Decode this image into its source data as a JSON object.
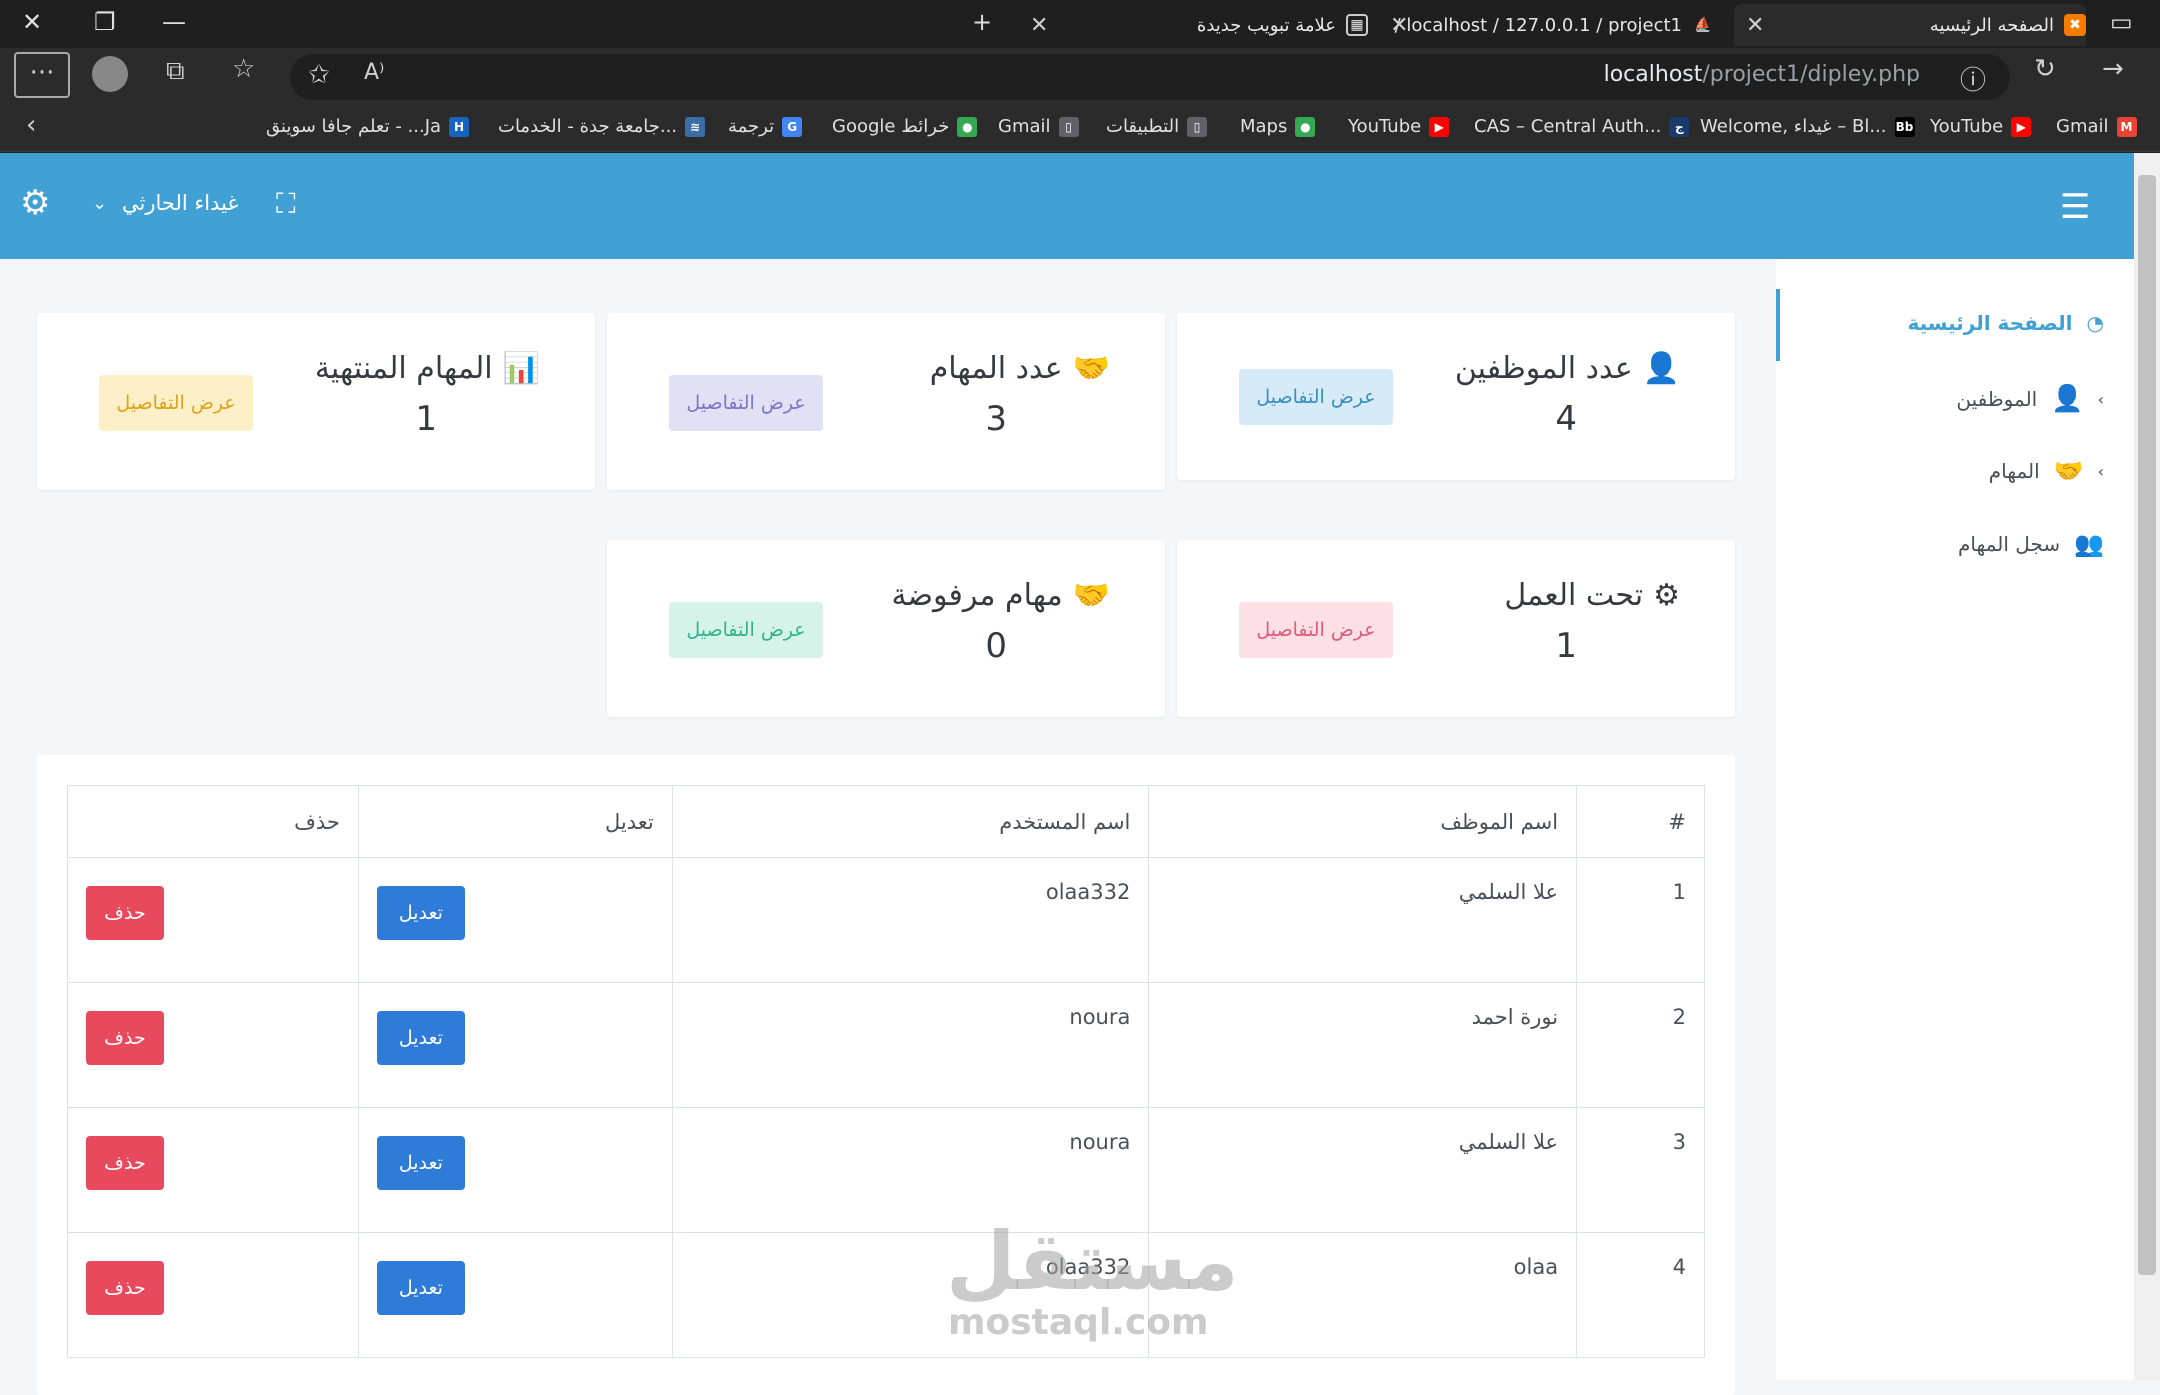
{
  "browser": {
    "tabs": [
      {
        "label": "الصفحه الرئيسيه",
        "active": true
      },
      {
        "label": "localhost / 127.0.0.1 / project1 /",
        "active": false
      },
      {
        "label": "علامة تبويب جديدة",
        "active": false
      }
    ],
    "url_host": "localhost",
    "url_path": "/project1/dipley.php",
    "bookmarks": [
      {
        "label": "Gmail",
        "icon": "gmail-icon",
        "color": "#ea4335",
        "glyph": "M"
      },
      {
        "label": "YouTube",
        "icon": "youtube-icon",
        "color": "#ff0000",
        "glyph": "▶"
      },
      {
        "label": "Welcome, غيداء – Bl...",
        "icon": "blackboard-icon",
        "color": "#000000",
        "glyph": "Bb"
      },
      {
        "label": "CAS – Central Auth...",
        "icon": "cas-icon",
        "color": "#1a3a6b",
        "glyph": "ج"
      },
      {
        "label": "YouTube",
        "icon": "youtube-icon",
        "color": "#ff0000",
        "glyph": "▶"
      },
      {
        "label": "Maps",
        "icon": "maps-icon",
        "color": "#34a853",
        "glyph": "●"
      },
      {
        "label": "التطبيقات",
        "icon": "file-icon",
        "color": "#5f6368",
        "glyph": "▯"
      },
      {
        "label": "Gmail",
        "icon": "file-icon",
        "color": "#5f6368",
        "glyph": "▯"
      },
      {
        "label": "Google خرائط",
        "icon": "maps-icon",
        "color": "#34a853",
        "glyph": "●"
      },
      {
        "label": "ترجمة",
        "icon": "translate-icon",
        "color": "#4285f4",
        "glyph": "G"
      },
      {
        "label": "جامعة جدة - الخدمات...",
        "icon": "university-icon",
        "color": "#3b6ea5",
        "glyph": "≋"
      },
      {
        "label": "تعلم جافا سوينق - ...Ja",
        "icon": "h-icon",
        "color": "#1565c0",
        "glyph": "H"
      }
    ]
  },
  "header": {
    "user_name": "غيداء الحارثي"
  },
  "sidebar": {
    "items": [
      {
        "label": "الصفحة الرئيسية",
        "icon": "dashboard-icon",
        "active": true
      },
      {
        "label": "الموظفين",
        "icon": "users-cog-icon",
        "active": false,
        "has_children": true
      },
      {
        "label": "المهام",
        "icon": "handshake-icon",
        "active": false,
        "has_children": true
      },
      {
        "label": "سجل المهام",
        "icon": "users-icon",
        "active": false
      }
    ]
  },
  "cards": [
    {
      "title": "عدد الموظفين",
      "value": "4",
      "button": "عرض التفاصيل",
      "icon": "users-cog-icon",
      "btn_bg": "#d6ebf7",
      "btn_color": "#3a8fbf"
    },
    {
      "title": "عدد المهام",
      "value": "3",
      "button": "عرض التفاصيل",
      "icon": "handshake-icon",
      "btn_bg": "#e1e0f5",
      "btn_color": "#7a77c9"
    },
    {
      "title": "المهام المنتهية",
      "value": "1",
      "button": "عرض التفاصيل",
      "icon": "chart-icon",
      "btn_bg": "#fdf0c9",
      "btn_color": "#e0a21a"
    },
    {
      "title": "تحت العمل",
      "value": "1",
      "button": "عرض التفاصيل",
      "icon": "gear-icon",
      "btn_bg": "#fde0e6",
      "btn_color": "#e05a7a"
    },
    {
      "title": "مهام مرفوضة",
      "value": "0",
      "button": "عرض التفاصيل",
      "icon": "handshake-icon",
      "btn_bg": "#d6f3e9",
      "btn_color": "#2fb58a"
    }
  ],
  "table": {
    "headers": [
      "#",
      "اسم الموظف",
      "اسم المستخدم",
      "تعديل",
      "حذف"
    ],
    "rows": [
      {
        "num": "1",
        "name": "علا السلمي",
        "username": "olaa332",
        "edit": "تعديل",
        "delete": "حذف"
      },
      {
        "num": "2",
        "name": "نورة احمد",
        "username": "noura",
        "edit": "تعديل",
        "delete": "حذف"
      },
      {
        "num": "3",
        "name": "علا السلمي",
        "username": "noura",
        "edit": "تعديل",
        "delete": "حذف"
      },
      {
        "num": "4",
        "name": "olaa",
        "username": "olaa332",
        "edit": "تعديل",
        "delete": "حذف"
      }
    ]
  },
  "watermark": {
    "arabic": "مستقل",
    "latin": "mostaql.com"
  }
}
